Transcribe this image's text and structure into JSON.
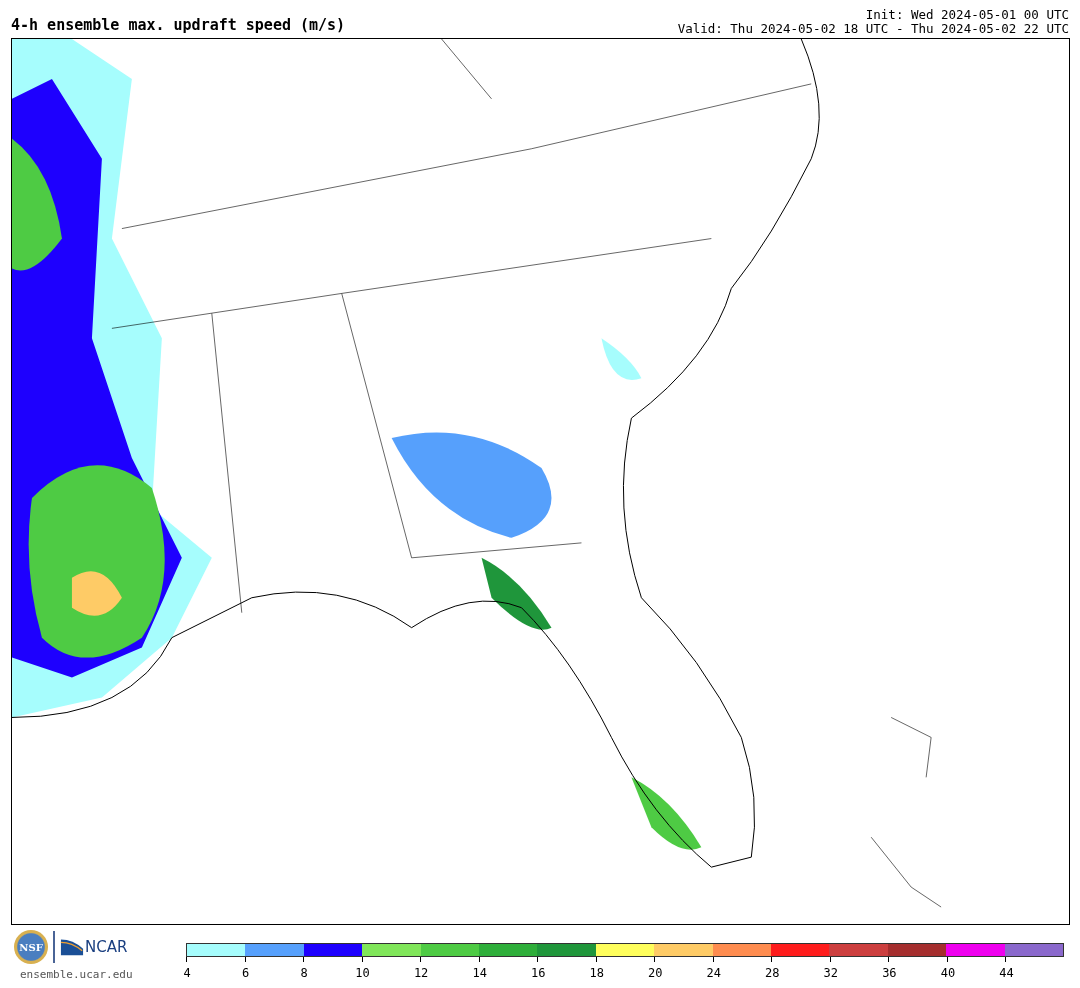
{
  "title": "4-h ensemble max. updraft speed (m/s)",
  "init": "Init: Wed 2024-05-01 00 UTC",
  "valid": "Valid: Thu 2024-05-02 18 UTC - Thu 2024-05-02 22 UTC",
  "logos": {
    "nsf": "NSF",
    "ncar": "NCAR",
    "url": "ensemble.ucar.edu"
  },
  "colorbar": [
    {
      "label": "4",
      "color": "#a6fdfd"
    },
    {
      "label": "6",
      "color": "#56a0fc"
    },
    {
      "label": "8",
      "color": "#1e00fe"
    },
    {
      "label": "10",
      "color": "#80e65a"
    },
    {
      "label": "12",
      "color": "#4ecb44"
    },
    {
      "label": "14",
      "color": "#2fae3a"
    },
    {
      "label": "16",
      "color": "#1f963b"
    },
    {
      "label": "18",
      "color": "#fefe5c"
    },
    {
      "label": "20",
      "color": "#fecb66"
    },
    {
      "label": "24",
      "color": "#fe8c4f"
    },
    {
      "label": "28",
      "color": "#fe1c1c"
    },
    {
      "label": "32",
      "color": "#cc3f3f"
    },
    {
      "label": "36",
      "color": "#a52e2e"
    },
    {
      "label": "40",
      "color": "#ee00ee"
    },
    {
      "label": "44",
      "color": "#8a68cc"
    }
  ]
}
